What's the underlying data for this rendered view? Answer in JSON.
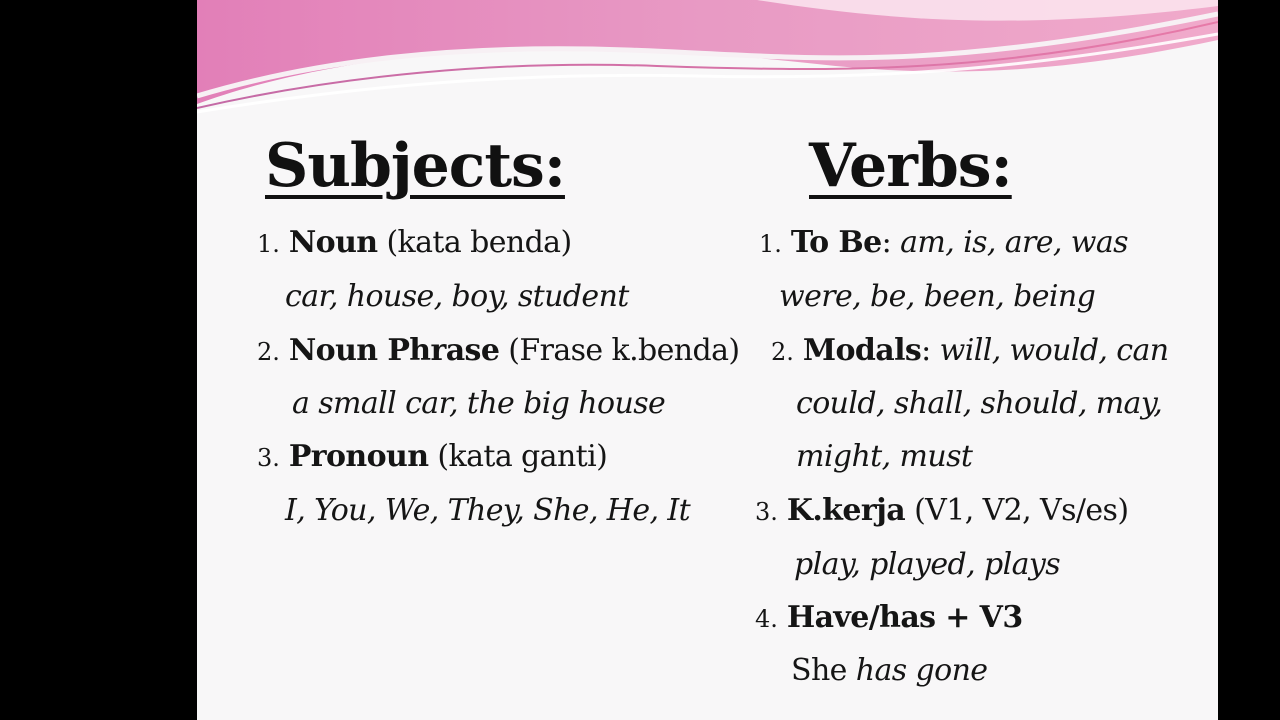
{
  "slide": {
    "colors": {
      "background": "#f8f7f8",
      "banner_pink": "#e17fb6",
      "banner_light": "#f4b5cf",
      "text": "#151515"
    },
    "subjects": {
      "heading": "Subjects:",
      "items": [
        {
          "number": "1.",
          "term": "Noun",
          "note": "(kata benda)",
          "examples": "car, house, boy, student"
        },
        {
          "number": "2.",
          "term": "Noun Phrase",
          "note": "(Frase k.benda)",
          "examples": "a small car, the big house"
        },
        {
          "number": "3.",
          "term": "Pronoun",
          "note": "(kata ganti)",
          "examples": "I, You, We, They, She, He, It"
        }
      ]
    },
    "verbs": {
      "heading": "Verbs:",
      "items": [
        {
          "number": "1.",
          "term": "To Be",
          "separator": ":",
          "inline": "am, is, are, was",
          "examples": [
            "were, be, been, being"
          ]
        },
        {
          "number": "2.",
          "term": "Modals",
          "separator": ":",
          "inline": "will, would, can",
          "examples": [
            "could, shall, should, may,",
            "might, must"
          ]
        },
        {
          "number": "3.",
          "term": "K.kerja",
          "note": "(V1, V2, Vs/es)",
          "examples": [
            "play, played, plays"
          ]
        },
        {
          "number": "4.",
          "term": "Have/has + V3",
          "example_plain": "She",
          "example_italic": "has gone"
        }
      ]
    }
  }
}
